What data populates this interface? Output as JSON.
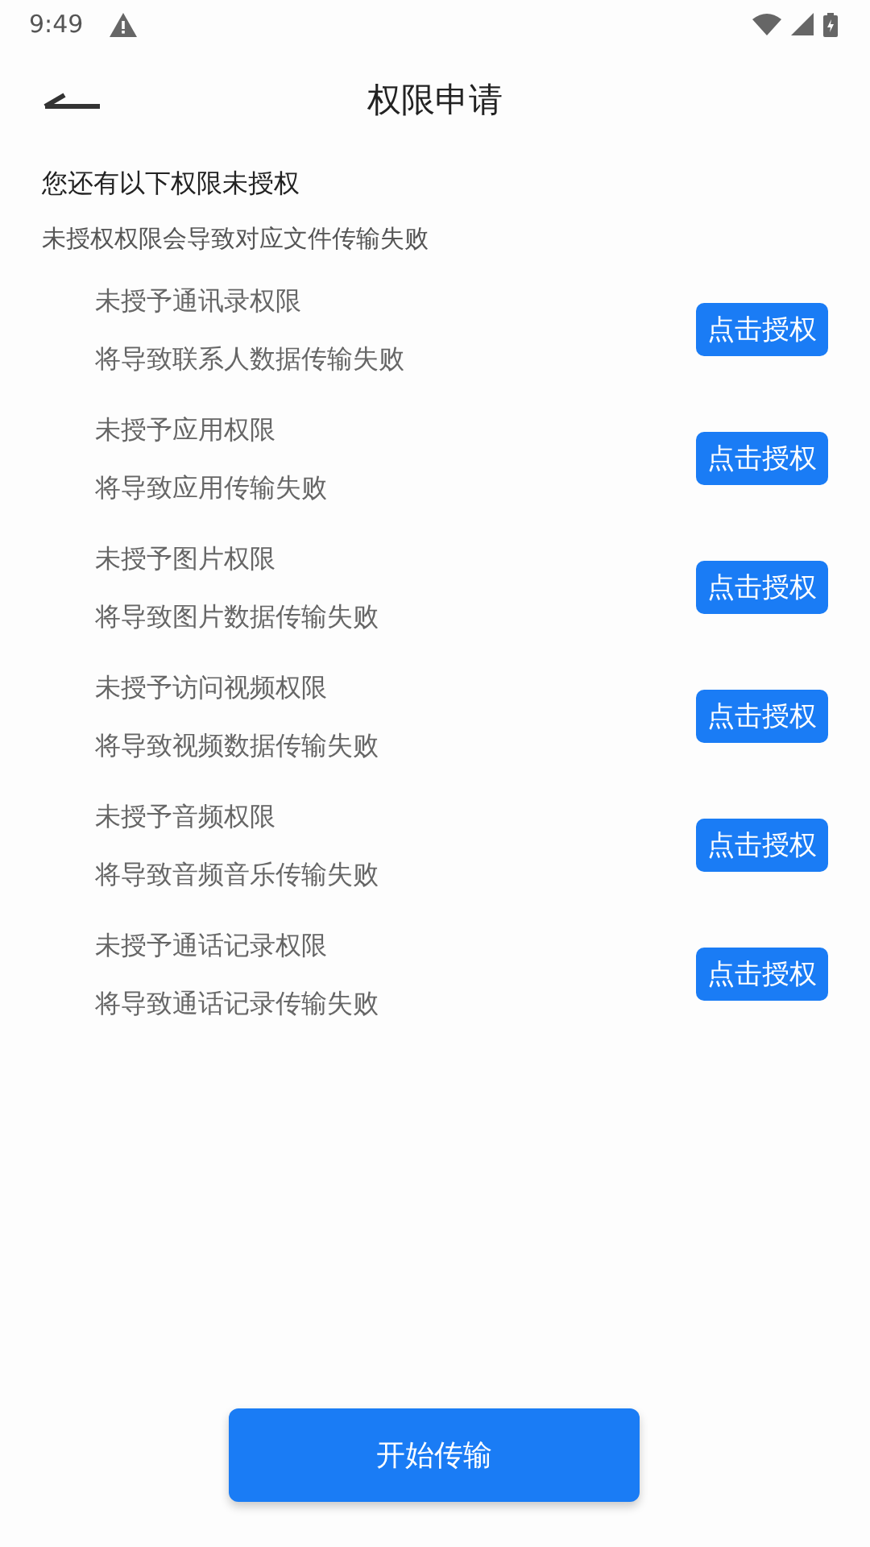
{
  "status_bar": {
    "time": "9:49"
  },
  "header": {
    "title": "权限申请"
  },
  "intro": {
    "heading": "您还有以下权限未授权",
    "note": "未授权权限会导致对应文件传输失败"
  },
  "permissions": [
    {
      "title": "未授予通讯录权限",
      "consequence": "将导致联系人数据传输失败",
      "button": "点击授权"
    },
    {
      "title": "未授予应用权限",
      "consequence": "将导致应用传输失败",
      "button": "点击授权"
    },
    {
      "title": "未授予图片权限",
      "consequence": "将导致图片数据传输失败",
      "button": "点击授权"
    },
    {
      "title": "未授予访问视频权限",
      "consequence": "将导致视频数据传输失败",
      "button": "点击授权"
    },
    {
      "title": "未授予音频权限",
      "consequence": "将导致音频音乐传输失败",
      "button": "点击授权"
    },
    {
      "title": "未授予通话记录权限",
      "consequence": "将导致通话记录传输失败",
      "button": "点击授权"
    }
  ],
  "start_button": "开始传输"
}
